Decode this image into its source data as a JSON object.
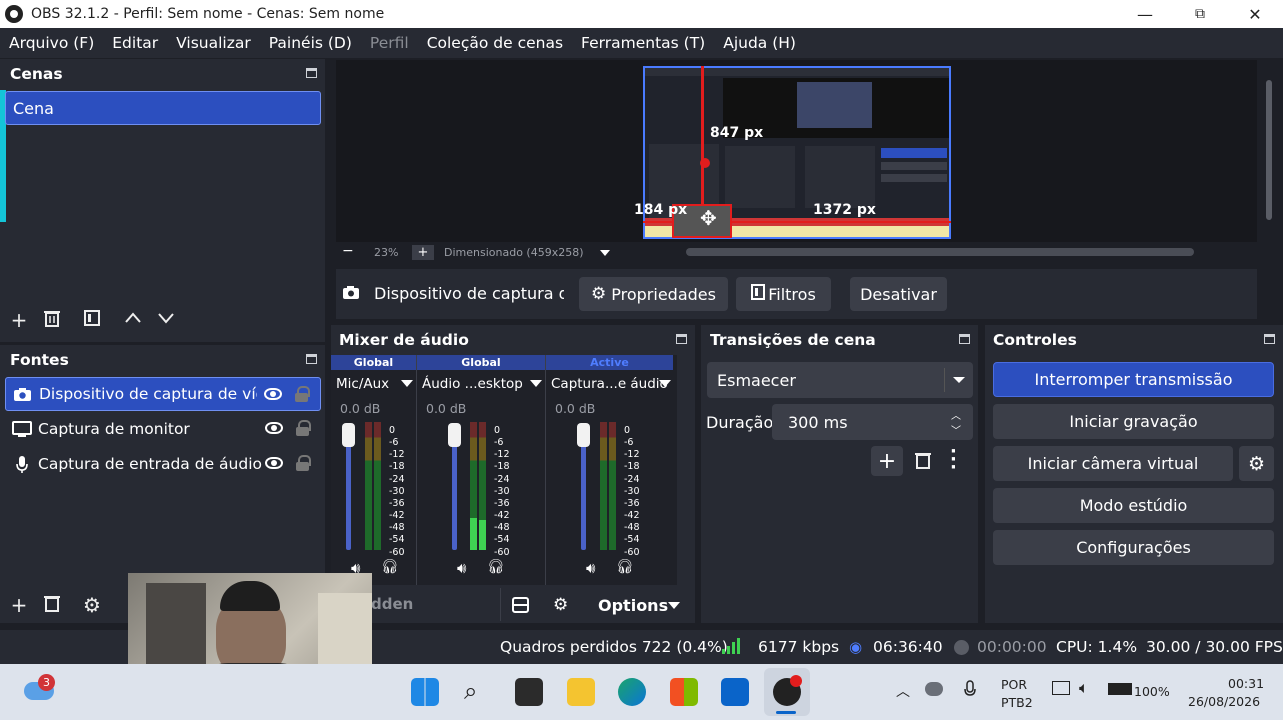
{
  "titlebar": {
    "title": "OBS 32.1.2 - Perfil: Sem nome - Cenas: Sem nome",
    "minimize": "—",
    "maximize": "⧉",
    "close": "✕"
  },
  "menu": [
    "Arquivo (F)",
    "Editar",
    "Visualizar",
    "Painéis (D)",
    "Perfil",
    "Coleção de cenas",
    "Ferramentas (T)",
    "Ajuda (H)"
  ],
  "scenes": {
    "title": "Cenas",
    "items": [
      "Cena"
    ]
  },
  "sources": {
    "title": "Fontes",
    "items": [
      "Dispositivo de captura de vídeo",
      "Captura de monitor",
      "Captura de entrada de áudio"
    ],
    "bottom_hidden_label": "dden"
  },
  "preview": {
    "zoom": "23%",
    "zoom_minus": "−",
    "zoom_plus": "+",
    "scale_mode": "Dimensionado (459x258)",
    "label_top": "847 px",
    "label_left": "184 px",
    "label_right": "1372 px"
  },
  "source_toolbar": {
    "source_name": "Dispositivo de captura de \\",
    "properties": "Propriedades",
    "filters": "Filtros",
    "deactivate": "Desativar"
  },
  "mixer": {
    "title": "Mixer de áudio",
    "channels": [
      {
        "header": "Global",
        "name": "Mic/Aux",
        "db": "0.0 dB"
      },
      {
        "header": "Global",
        "name": "Áudio ...esktop",
        "db": "0.0 dB"
      },
      {
        "header": "Active",
        "name": "Captura...e áudio",
        "db": "0.0 dB"
      }
    ],
    "scale": [
      "0",
      "-6",
      "-12",
      "-18",
      "-24",
      "-30",
      "-36",
      "-42",
      "-48",
      "-54",
      "-60"
    ],
    "options": "Options"
  },
  "transitions": {
    "title": "Transições de cena",
    "selected": "Esmaecer",
    "duration_label": "Duração",
    "duration_value": "300 ms"
  },
  "controls": {
    "title": "Controles",
    "stop_stream": "Interromper transmissão",
    "start_recording": "Iniciar gravação",
    "start_virtual_cam": "Iniciar câmera virtual",
    "studio_mode": "Modo estúdio",
    "settings": "Configurações"
  },
  "status": {
    "dropped_frames": "Quadros perdidos 722 (0.4%)",
    "bitrate": "6177 kbps",
    "stream_time": "06:36:40",
    "rec_time": "00:00:00",
    "cpu": "CPU: 1.4%",
    "fps": "30.00 / 30.00 FPS"
  },
  "taskbar": {
    "weather_badge": "3",
    "lang": "POR",
    "layout": "PTB2",
    "battery": "100%",
    "time": "00:31",
    "date": "26/08/2026"
  },
  "colors": {
    "accent": "#2c4fbf",
    "panel": "#272a33",
    "background": "#1d1f26",
    "button": "#3b3e48"
  }
}
